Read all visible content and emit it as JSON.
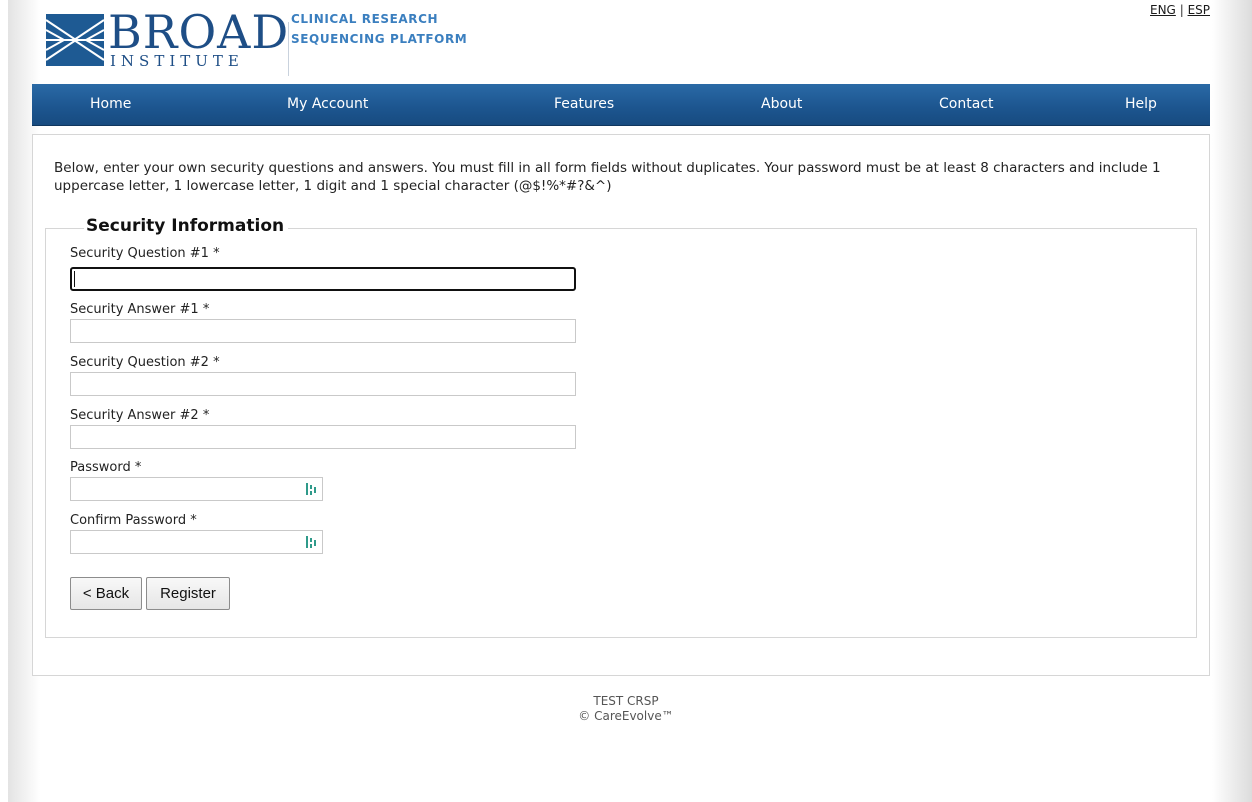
{
  "header": {
    "logo_word": "BROAD",
    "logo_sub": "INSTITUTE",
    "platform_line1": "CLINICAL RESEARCH",
    "platform_line2": "SEQUENCING PLATFORM",
    "lang_eng": "ENG",
    "lang_sep": "|",
    "lang_esp": "ESP"
  },
  "nav": {
    "items": [
      "Home",
      "My Account",
      "Features",
      "About",
      "Contact",
      "Help"
    ]
  },
  "main": {
    "intro": "Below, enter your own security questions and answers. You must fill in all form fields without duplicates. Your password must be at least 8 characters and include 1 uppercase letter, 1 lowercase letter, 1 digit and 1 special character (@$!%*#?&^)",
    "legend": "Security Information",
    "fields": [
      {
        "label": "Security Question #1 *",
        "value": ""
      },
      {
        "label": "Security Answer #1 *",
        "value": ""
      },
      {
        "label": "Security Question #2 *",
        "value": ""
      },
      {
        "label": "Security Answer #2 *",
        "value": ""
      },
      {
        "label": "Password *",
        "value": ""
      },
      {
        "label": "Confirm Password *",
        "value": ""
      }
    ],
    "back_label": "< Back",
    "register_label": "Register"
  },
  "footer": {
    "line1": "TEST CRSP",
    "line2": "© CareEvolve™"
  },
  "colors": {
    "nav": "#1d5690",
    "brand": "#1e4e86",
    "platform": "#3b7fbf"
  },
  "icons": {
    "logo_mark": "broad-logo-icon",
    "password_manager": "password-manager-icon"
  }
}
